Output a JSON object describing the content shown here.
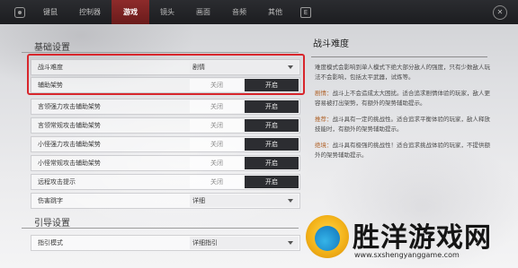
{
  "tabs": [
    "键鼠",
    "控制器",
    "游戏",
    "镜头",
    "画面",
    "音频",
    "其他"
  ],
  "active_tab": "游戏",
  "e_key": "E",
  "close_glyph": "✕",
  "sections": {
    "basic": "基础设置",
    "guide": "引导设置"
  },
  "settings": [
    {
      "label": "战斗难度",
      "type": "select",
      "value": "剧情"
    },
    {
      "label": "辅助架势",
      "type": "toggle",
      "off": "关闭",
      "on": "开启"
    },
    {
      "label": "言领强力攻击辅助架势",
      "type": "toggle",
      "off": "关闭",
      "on": "开启"
    },
    {
      "label": "言领常规攻击辅助架势",
      "type": "toggle",
      "off": "关闭",
      "on": "开启"
    },
    {
      "label": "小怪强力攻击辅助架势",
      "type": "toggle",
      "off": "关闭",
      "on": "开启"
    },
    {
      "label": "小怪常规攻击辅助架势",
      "type": "toggle",
      "off": "关闭",
      "on": "开启"
    },
    {
      "label": "远程攻击提示",
      "type": "toggle",
      "off": "关闭",
      "on": "开启"
    },
    {
      "label": "伤害跳字",
      "type": "select",
      "value": "详细"
    },
    {
      "label": "指引模式",
      "type": "select",
      "value": "详细指引"
    }
  ],
  "panel": {
    "title": "战斗难度",
    "intro": "难度模式会影响到单人模式下绝大部分敌人的强度，只有少数敌人玩法不会影响，包括太平武器，试炼等。",
    "items": [
      {
        "key": "剧情：",
        "text": "战斗上不会造成太大困扰。适合追求剧情体验的玩家，敌人更容易被打出架势，有额外的架势辅助提示。"
      },
      {
        "key": "推荐：",
        "text": "战斗具有一定的挑战性。适合追求平衡体验的玩家，敌人释放技能时，有额外的架势辅助提示。"
      },
      {
        "key": "绝境：",
        "text": "战斗具有极强的挑战性！适合追求挑战体验的玩家，不提供额外的架势辅助提示。"
      }
    ]
  },
  "watermark": {
    "text": "胜洋游戏网",
    "url": "www.sxshengyanggame.com"
  },
  "colors": {
    "highlight": "#d8262c",
    "active_tab": "#8e2b2b",
    "on_button": "#2c2d31",
    "key_text": "#b0642b"
  }
}
